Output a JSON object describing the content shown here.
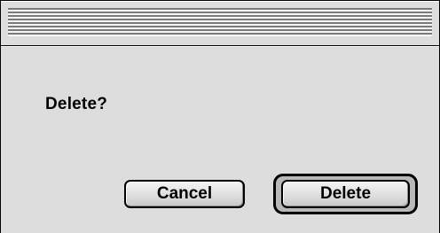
{
  "dialog": {
    "message": "Delete?",
    "buttons": {
      "cancel_label": "Cancel",
      "delete_label": "Delete",
      "default_button": "Delete"
    }
  },
  "colors": {
    "window_background": "#dddddd",
    "titlebar_stripe_dark": "#7a7a7a",
    "titlebar_stripe_light": "#f4f4f4",
    "border": "#000000"
  }
}
